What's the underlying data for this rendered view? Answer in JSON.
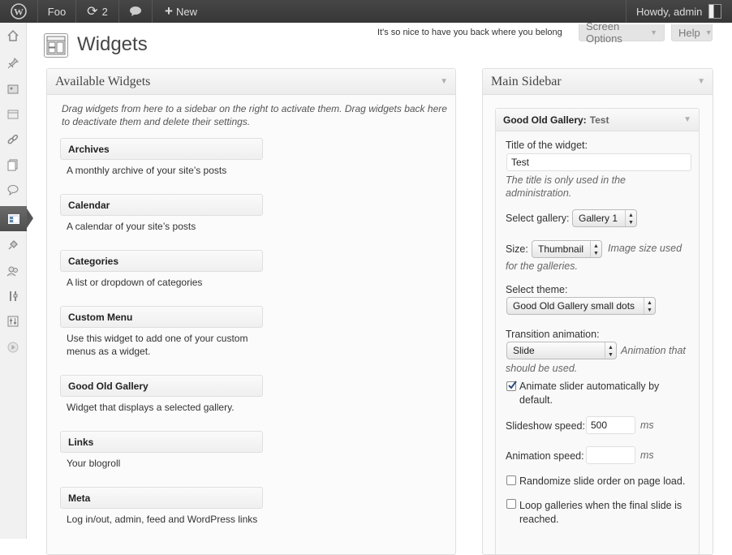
{
  "adminbar": {
    "site_name": "Foo",
    "updates_count": "2",
    "new_label": "New",
    "howdy": "Howdy, admin"
  },
  "header": {
    "title": "Widgets",
    "notice": "It's so nice to have you back where you belong",
    "screen_options": "Screen Options",
    "help": "Help"
  },
  "available": {
    "title": "Available Widgets",
    "intro": "Drag widgets from here to a sidebar on the right to activate them. Drag widgets back here to deactivate them and delete their settings.",
    "widgets": [
      {
        "name": "Archives",
        "desc": "A monthly archive of your site’s posts"
      },
      {
        "name": "Calendar",
        "desc": "A calendar of your site’s posts"
      },
      {
        "name": "Categories",
        "desc": "A list or dropdown of categories"
      },
      {
        "name": "Custom Menu",
        "desc": "Use this widget to add one of your custom menus as a widget."
      },
      {
        "name": "Good Old Gallery",
        "desc": "Widget that displays a selected gallery."
      },
      {
        "name": "Links",
        "desc": "Your blogroll"
      },
      {
        "name": "Meta",
        "desc": "Log in/out, admin, feed and WordPress links"
      }
    ]
  },
  "sidebar": {
    "title": "Main Sidebar",
    "widget_name": "Good Old Gallery:",
    "widget_title_suffix": "Test",
    "title_label": "Title of the widget:",
    "title_value": "Test",
    "title_hint": "The title is only used in the administration.",
    "gallery_label": "Select gallery:",
    "gallery_value": "Gallery 1",
    "size_label": "Size:",
    "size_value": "Thumbnail",
    "size_hint_a": "Image size used",
    "size_hint_b": "for the galleries.",
    "theme_label": "Select theme:",
    "theme_value": "Good Old Gallery small dots",
    "transition_label": "Transition animation:",
    "transition_value": "Slide",
    "transition_hint_a": "Animation that",
    "transition_hint_b": "should be used.",
    "autoplay_label": "Animate slider automatically by default.",
    "autoplay_checked": true,
    "slideshow_speed_label": "Slideshow speed:",
    "slideshow_speed_value": "500",
    "animation_speed_label": "Animation speed:",
    "animation_speed_value": "",
    "ms": "ms",
    "randomize_label": "Randomize slide order on page load.",
    "randomize_checked": false,
    "loop_label": "Loop galleries when the final slide is reached.",
    "loop_checked": false
  },
  "menu_icons": [
    "dashboard-icon",
    "posts-icon",
    "media-icon",
    "pages-icon",
    "links-icon",
    "pages2-icon",
    "comments-icon",
    "appearance-icon",
    "plugins-icon",
    "users-icon",
    "tools-icon",
    "settings-icon",
    "collapse-icon"
  ]
}
